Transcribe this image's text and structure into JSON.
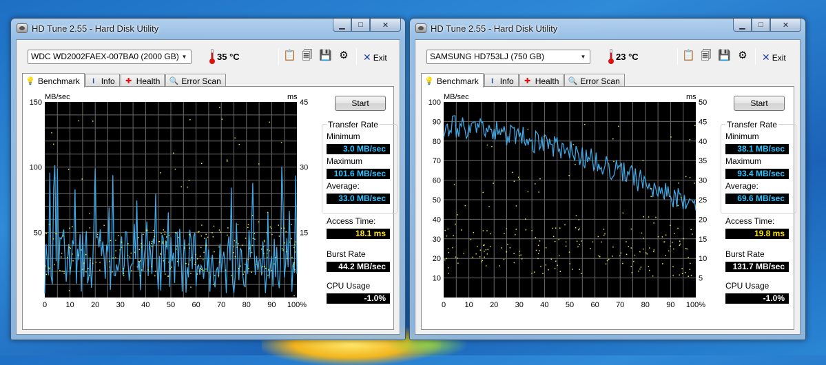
{
  "windows": [
    {
      "title": "HD Tune 2.55 - Hard Disk Utility",
      "drive": "WDC WD2002FAEX-007BA0 (2000 GB)",
      "temperature": "35 °C",
      "toolbar": {
        "exit_label": "Exit"
      },
      "tabs": [
        "Benchmark",
        "Info",
        "Health",
        "Error Scan"
      ],
      "start_label": "Start",
      "transfer_rate": {
        "title": "Transfer Rate",
        "minimum_label": "Minimum",
        "minimum": "3.0 MB/sec",
        "maximum_label": "Maximum",
        "maximum": "101.6 MB/sec",
        "average_label": "Average:",
        "average": "33.0 MB/sec"
      },
      "access_time_label": "Access Time:",
      "access_time": "18.1 ms",
      "burst_rate_label": "Burst Rate",
      "burst_rate": "44.2 MB/sec",
      "cpu_usage_label": "CPU Usage",
      "cpu_usage": "-1.0%",
      "chart": {
        "left_unit": "MB/sec",
        "right_unit": "ms",
        "y_ticks": [
          {
            "v": 50,
            "label": "50"
          },
          {
            "v": 100,
            "label": "100"
          },
          {
            "v": 150,
            "label": "150"
          }
        ],
        "ms_ticks": [
          {
            "v": 15,
            "label": "15"
          },
          {
            "v": 30,
            "label": "30"
          },
          {
            "v": 45,
            "label": "45"
          }
        ],
        "x_ticks": [
          "0",
          "10",
          "20",
          "30",
          "40",
          "50",
          "60",
          "70",
          "80",
          "90",
          "100%"
        ],
        "y_max": 150,
        "ms_max": 45
      }
    },
    {
      "title": "HD Tune 2.55 - Hard Disk Utility",
      "drive": "SAMSUNG HD753LJ (750 GB)",
      "temperature": "23 °C",
      "toolbar": {
        "exit_label": "Exit"
      },
      "tabs": [
        "Benchmark",
        "Info",
        "Health",
        "Error Scan"
      ],
      "start_label": "Start",
      "transfer_rate": {
        "title": "Transfer Rate",
        "minimum_label": "Minimum",
        "minimum": "38.1 MB/sec",
        "maximum_label": "Maximum",
        "maximum": "93.4 MB/sec",
        "average_label": "Average:",
        "average": "69.6 MB/sec"
      },
      "access_time_label": "Access Time:",
      "access_time": "19.8 ms",
      "burst_rate_label": "Burst Rate",
      "burst_rate": "131.7 MB/sec",
      "cpu_usage_label": "CPU Usage",
      "cpu_usage": "-1.0%",
      "chart": {
        "left_unit": "MB/sec",
        "right_unit": "ms",
        "y_ticks": [
          {
            "v": 10,
            "label": "10"
          },
          {
            "v": 20,
            "label": "20"
          },
          {
            "v": 30,
            "label": "30"
          },
          {
            "v": 40,
            "label": "40"
          },
          {
            "v": 50,
            "label": "50"
          },
          {
            "v": 60,
            "label": "60"
          },
          {
            "v": 70,
            "label": "70"
          },
          {
            "v": 80,
            "label": "80"
          },
          {
            "v": 90,
            "label": "90"
          },
          {
            "v": 100,
            "label": "100"
          }
        ],
        "ms_ticks": [
          {
            "v": 5,
            "label": "5"
          },
          {
            "v": 10,
            "label": "10"
          },
          {
            "v": 15,
            "label": "15"
          },
          {
            "v": 20,
            "label": "20"
          },
          {
            "v": 25,
            "label": "25"
          },
          {
            "v": 30,
            "label": "30"
          },
          {
            "v": 35,
            "label": "35"
          },
          {
            "v": 40,
            "label": "40"
          },
          {
            "v": 45,
            "label": "45"
          },
          {
            "v": 50,
            "label": "50"
          }
        ],
        "x_ticks": [
          "0",
          "10",
          "20",
          "30",
          "40",
          "50",
          "60",
          "70",
          "80",
          "90",
          "100%"
        ],
        "y_max": 100,
        "ms_max": 50
      }
    }
  ],
  "colors": {
    "transfer_line": "#3fa9e6",
    "access_dots": "#e6e64a",
    "grid": "#6a6a6a",
    "plot_bg": "#000000"
  }
}
